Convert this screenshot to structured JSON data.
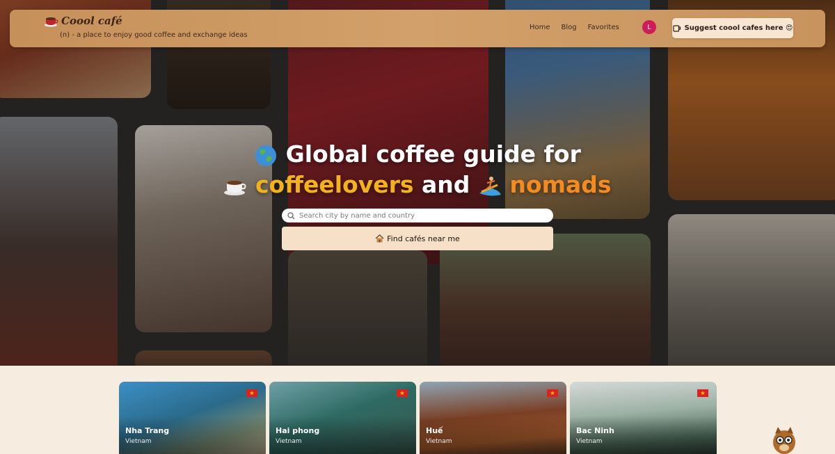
{
  "header": {
    "logo_text": "Coool café",
    "tagline": "(n) - a place to enjoy good coffee and exchange ideas",
    "nav": [
      "Home",
      "Blog",
      "Favorites"
    ],
    "avatar_initial": "L",
    "suggest_label": "Suggest coool cafes here 😍"
  },
  "hero": {
    "line1_text": "Global coffee guide for",
    "line2_word1": "coffeelovers",
    "line2_and": "and",
    "line2_word2": "nomads",
    "search_placeholder": "Search city by name and country",
    "find_label": "Find cafés near me"
  },
  "cities": [
    {
      "name": "Nha Trang",
      "country": "Vietnam"
    },
    {
      "name": "Hai phong",
      "country": "Vietnam"
    },
    {
      "name": "Huế",
      "country": "Vietnam"
    },
    {
      "name": "Bac Ninh",
      "country": "Vietnam"
    }
  ],
  "colors": {
    "header_bg": "#c6905a",
    "accent_yellow": "#f3b21c",
    "accent_orange": "#f58a1f",
    "button_bg": "#f6e0c8",
    "page_bg": "#f7ece0",
    "avatar": "#d11a5b"
  },
  "icons": [
    "coffee-cup-icon",
    "globe-icon",
    "surfer-icon",
    "house-icon",
    "search-icon",
    "vietnam-flag-icon",
    "mascot-icon"
  ]
}
